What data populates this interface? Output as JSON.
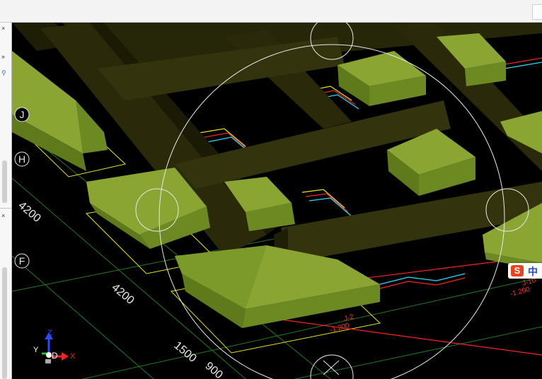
{
  "left_panel": {
    "icons": [
      "close-icon",
      "expand-right-icon",
      "search-icon",
      "close-icon"
    ],
    "glyphs": [
      "×",
      "»",
      "⚲",
      "×"
    ]
  },
  "grid_axes": {
    "labels": [
      "J",
      "H",
      "F"
    ]
  },
  "dimensions": {
    "labels": [
      "4200",
      "4200",
      "1500",
      "900"
    ]
  },
  "foundation_tags": {
    "tag_1_line1": "J-2",
    "tag_1_line2": "-1.200",
    "tag_2_line1": "J-10",
    "tag_2_line2": "-1.200"
  },
  "ucs_icon": {
    "axis_x": "X",
    "axis_y": "Y",
    "axis_z": "Z",
    "mode": "D"
  },
  "ime_toolbar": {
    "logo": "S",
    "language": "中"
  },
  "colors": {
    "footing": "#7a9a2a",
    "beam": "#2e2e0c",
    "background": "#000000",
    "grid_line": "#1f7a1f",
    "accent_red": "#ff2020",
    "accent_yellow": "#e6e600",
    "accent_cyan": "#20e0ff"
  }
}
